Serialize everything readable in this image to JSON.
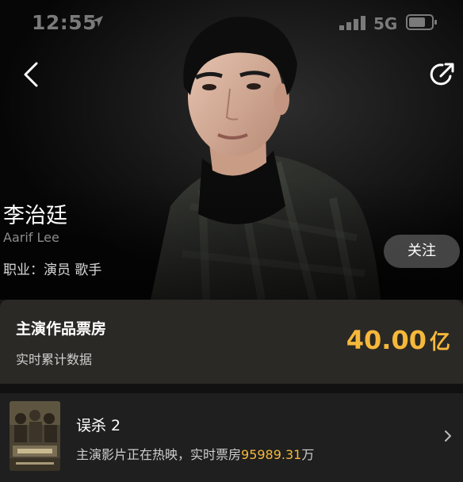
{
  "status_bar": {
    "time": "12:55",
    "network": "5G"
  },
  "actor": {
    "name_cn": "李治廷",
    "name_en": "Aarif Lee",
    "profession": "职业：演员 歌手",
    "follow_label": "关注"
  },
  "box_office": {
    "title": "主演作品票房",
    "subtitle": "实时累计数据",
    "value": "40.00",
    "unit": "亿"
  },
  "movie": {
    "title": "误杀 2",
    "desc_prefix": "主演影片正在热映，实时票房",
    "amount": "95989.31",
    "unit": "万"
  },
  "icons": {
    "back": "chevron-left-icon",
    "share": "share-icon",
    "row_arrow": "chevron-right-icon"
  },
  "colors": {
    "accent": "#f6b83a",
    "card_bg": "#2b2926",
    "follow_bg": "#505050"
  }
}
